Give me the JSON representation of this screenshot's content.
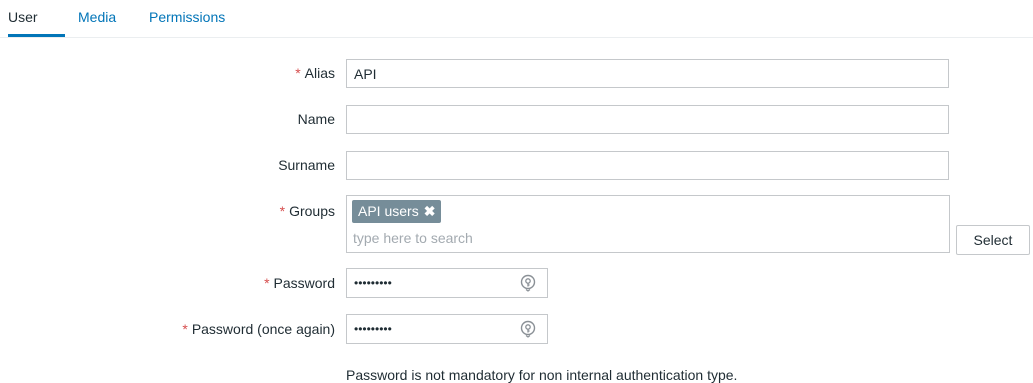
{
  "tabs": [
    {
      "label": "User",
      "active": true
    },
    {
      "label": "Media",
      "active": false
    },
    {
      "label": "Permissions",
      "active": false
    }
  ],
  "required_marker": "*",
  "form": {
    "alias": {
      "label": "Alias",
      "value": "API",
      "required": true
    },
    "name": {
      "label": "Name",
      "value": "",
      "required": false
    },
    "surname": {
      "label": "Surname",
      "value": "",
      "required": false
    },
    "groups": {
      "label": "Groups",
      "required": true,
      "selected": [
        {
          "label": "API users",
          "remove_symbol": "✖"
        }
      ],
      "placeholder": "type here to search",
      "select_button": "Select"
    },
    "password": {
      "label": "Password",
      "value": "•••••••••",
      "required": true
    },
    "password_again": {
      "label": "Password (once again)",
      "value": "•••••••••",
      "required": true
    },
    "password_note": "Password is not mandatory for non internal authentication type."
  },
  "colors": {
    "accent": "#0275b8",
    "required": "#d64e4e",
    "chip": "#768d99"
  }
}
